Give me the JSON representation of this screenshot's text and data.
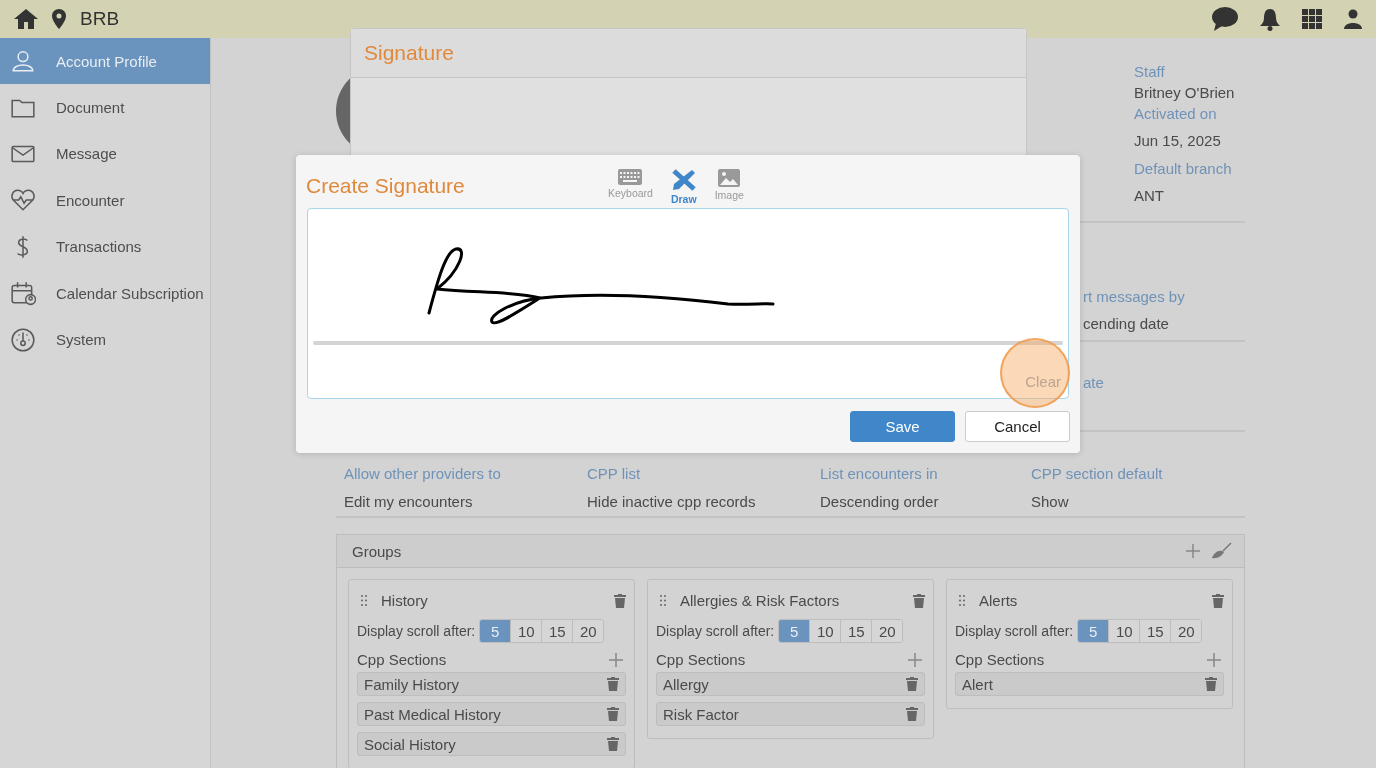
{
  "header": {
    "brand": "BRB"
  },
  "sidebar": {
    "items": [
      {
        "label": "Account Profile",
        "selected": true
      },
      {
        "label": "Document",
        "selected": false
      },
      {
        "label": "Message",
        "selected": false
      },
      {
        "label": "Encounter",
        "selected": false
      },
      {
        "label": "Transactions",
        "selected": false
      },
      {
        "label": "Calendar Subscription",
        "selected": false
      },
      {
        "label": "System",
        "selected": false
      }
    ]
  },
  "profile": {
    "fields": [
      {
        "label": "Staff",
        "value": "Britney O'Brien"
      },
      {
        "label": "Activated on",
        "value": "Jun 15, 2025"
      },
      {
        "label": "Default branch",
        "value": "ANT"
      }
    ]
  },
  "partial_settings": [
    {
      "label": "rt messages by",
      "value": "cending date"
    },
    {
      "label": "ate"
    }
  ],
  "settings": [
    {
      "label": "Allow other providers to",
      "value": "Edit my encounters"
    },
    {
      "label": "CPP list",
      "value": "Hide inactive cpp records"
    },
    {
      "label": "List encounters in",
      "value": "Descending order"
    },
    {
      "label": "CPP section default",
      "value": "Show"
    }
  ],
  "groups": {
    "title": "Groups",
    "cards": [
      {
        "title": "History",
        "scroll_label": "Display scroll after:",
        "scroll_options": [
          {
            "label": "5",
            "selected": true
          },
          {
            "label": "10",
            "selected": false
          },
          {
            "label": "15",
            "selected": false
          },
          {
            "label": "20",
            "selected": false
          }
        ],
        "sections_label": "Cpp Sections",
        "sections": [
          "Family History",
          "Past Medical History",
          "Social History"
        ]
      },
      {
        "title": "Allergies & Risk Factors",
        "scroll_label": "Display scroll after:",
        "scroll_options": [
          {
            "label": "5",
            "selected": true
          },
          {
            "label": "10",
            "selected": false
          },
          {
            "label": "15",
            "selected": false
          },
          {
            "label": "20",
            "selected": false
          }
        ],
        "sections_label": "Cpp Sections",
        "sections": [
          "Allergy",
          "Risk Factor"
        ]
      },
      {
        "title": "Alerts",
        "scroll_label": "Display scroll after:",
        "scroll_options": [
          {
            "label": "5",
            "selected": true
          },
          {
            "label": "10",
            "selected": false
          },
          {
            "label": "15",
            "selected": false
          },
          {
            "label": "20",
            "selected": false
          }
        ],
        "sections_label": "Cpp Sections",
        "sections": [
          "Alert"
        ]
      }
    ]
  },
  "signature_panel": {
    "title": "Signature"
  },
  "create_signature": {
    "title": "Create Signature",
    "tabs": [
      {
        "label": "Keyboard",
        "selected": false
      },
      {
        "label": "Draw",
        "selected": true
      },
      {
        "label": "Image",
        "selected": false
      }
    ],
    "clear": "Clear",
    "buttons": [
      {
        "label": "Save",
        "kind": "primary"
      },
      {
        "label": "Cancel",
        "kind": "secondary"
      }
    ]
  }
}
